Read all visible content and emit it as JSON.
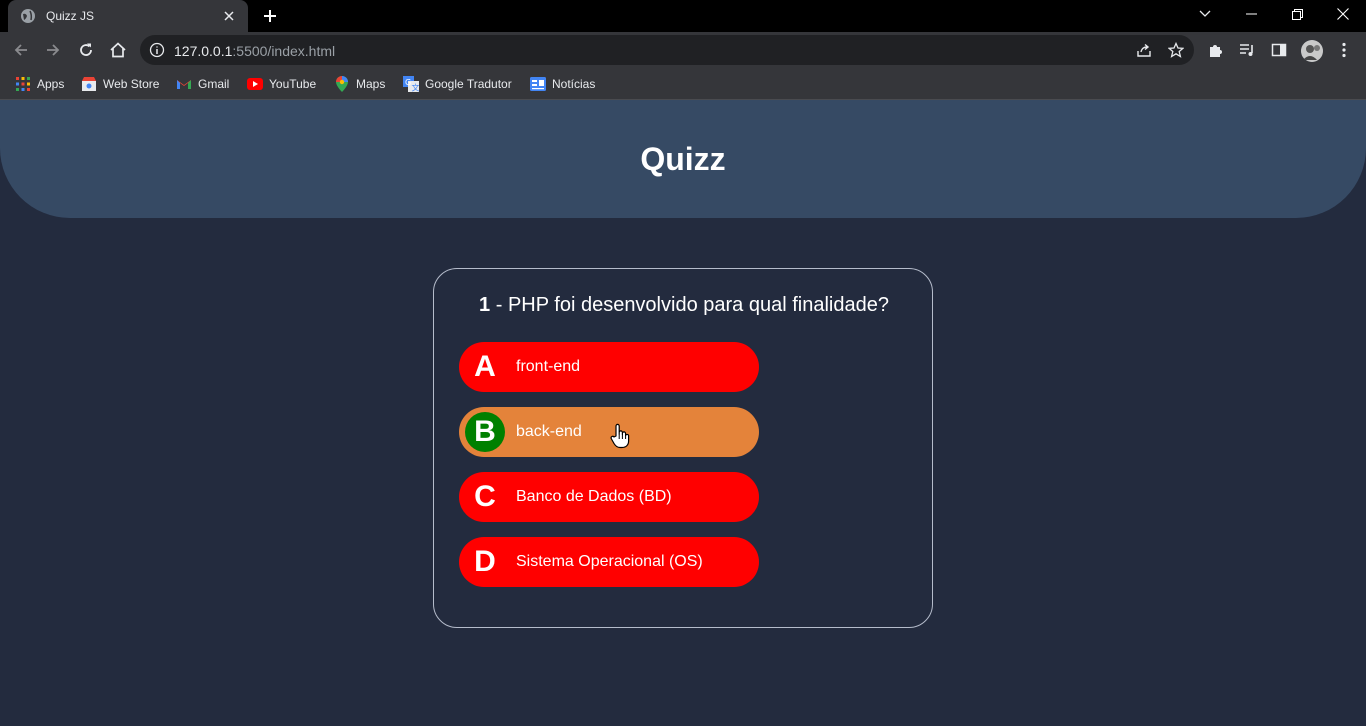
{
  "browser": {
    "tab_title": "Quizz JS",
    "url_host": "127.0.0.1",
    "url_rest": ":5500/index.html",
    "bookmarks": [
      {
        "label": "Apps",
        "icon": "apps-grid-icon"
      },
      {
        "label": "Web Store",
        "icon": "web-store-icon"
      },
      {
        "label": "Gmail",
        "icon": "gmail-icon"
      },
      {
        "label": "YouTube",
        "icon": "youtube-icon"
      },
      {
        "label": "Maps",
        "icon": "maps-icon"
      },
      {
        "label": "Google Tradutor",
        "icon": "google-translate-icon"
      },
      {
        "label": "Notícias",
        "icon": "news-icon"
      }
    ]
  },
  "page": {
    "title": "Quizz"
  },
  "quiz": {
    "question_number": "1",
    "question_text": " - PHP foi desenvolvido para qual finalidade?",
    "answers": [
      {
        "letter": "A",
        "text": "front-end",
        "state": "default"
      },
      {
        "letter": "B",
        "text": "back-end",
        "state": "hover-correct"
      },
      {
        "letter": "C",
        "text": "Banco de Dados (BD)",
        "state": "default"
      },
      {
        "letter": "D",
        "text": "Sistema Operacional (OS)",
        "state": "default"
      }
    ]
  },
  "colors": {
    "page_bg": "#232b3e",
    "header_bg": "#364a64",
    "answer_bg": "#ff0000",
    "answer_hover_bg": "#e4833a",
    "correct_letter_bg": "#008000"
  }
}
